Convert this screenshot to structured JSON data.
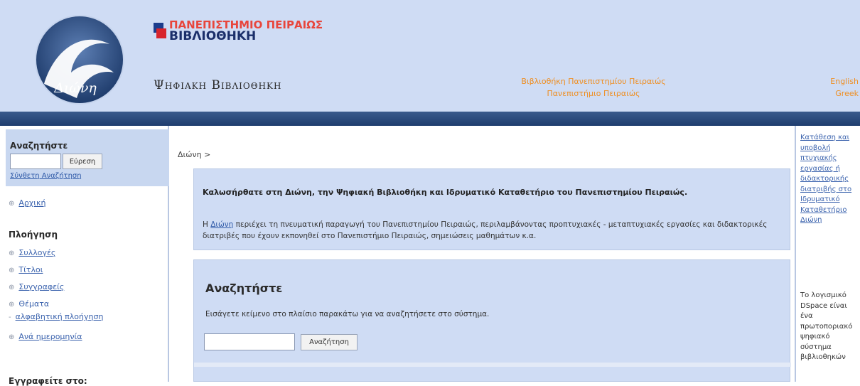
{
  "header": {
    "brand": "ΠΑΝΕΠΙΣΤΗΜΙΟ ΠΕΙΡΑΙΩΣ ΒΙΒΛΙΟΘΗΚΗ",
    "digital_title": "Ψηφιακη Βιβλιοθηκη",
    "logo_text": "Διώνη",
    "links": [
      "Βιβλιοθήκη Πανεπιστημίου Πειραιώς",
      "Πανεπιστήμιο Πειραιώς"
    ],
    "languages": [
      "English",
      "Greek"
    ]
  },
  "left_sidebar": {
    "search_heading": "Αναζητήστε",
    "search_button": "Εύρεση",
    "advanced_search": "Σύνθετη Αναζήτηση",
    "home": "Αρχική",
    "browse_heading": "Πλοήγηση",
    "browse_items": [
      "Συλλογές",
      "Τίτλοι",
      "Συγγραφείς",
      "Θέματα",
      "αλφαβητική πλοήγηση",
      "Ανά ημερομηνία"
    ],
    "subscribe_heading": "Εγγραφείτε στο:"
  },
  "main": {
    "breadcrumb": "Διώνη >",
    "welcome_heading": "Καλωσήρθατε στη Διώνη, την Ψηφιακή Βιβλιοθήκη και Ιδρυματικό Καταθετήριο του Πανεπιστημίου Πειραιώς.",
    "welcome_link": "Διώνη",
    "welcome_text": "περιέχει τη πνευματική παραγωγή του Πανεπιστημίου Πειραιώς, περιλαμβάνοντας προπτυχιακές - μεταπτυχιακές εργασίες και διδακτορικές διατριβές που έχουν εκπονηθεί στο Πανεπιστήμιο Πειραιώς, σημειώσεις μαθημάτων κ.α.",
    "welcome_prefix": "Η",
    "search_heading": "Αναζητήστε",
    "search_desc": "Εισάγετε κείμενο στο πλαίσιο παρακάτω για να αναζητήσετε στο σύστημα.",
    "search_button": "Αναζήτηση"
  },
  "right_sidebar": {
    "deposit_link": "Κατάθεση και υποβολή πτυχιακής εργασίας ή διδακτορικής διατριβής στο Ιδρυματικό Καταθετήριο Διώνη",
    "dspace_text": "Το λογισμικό DSpace είναι ένα πρωτοποριακό ψηφιακό σύστημα βιβλιοθηκών"
  },
  "colors": {
    "header_bg": "#cfdcf4",
    "stripe": "#2a4a7c",
    "accent_orange": "#ef8e20",
    "link_blue": "#3a62ad"
  }
}
